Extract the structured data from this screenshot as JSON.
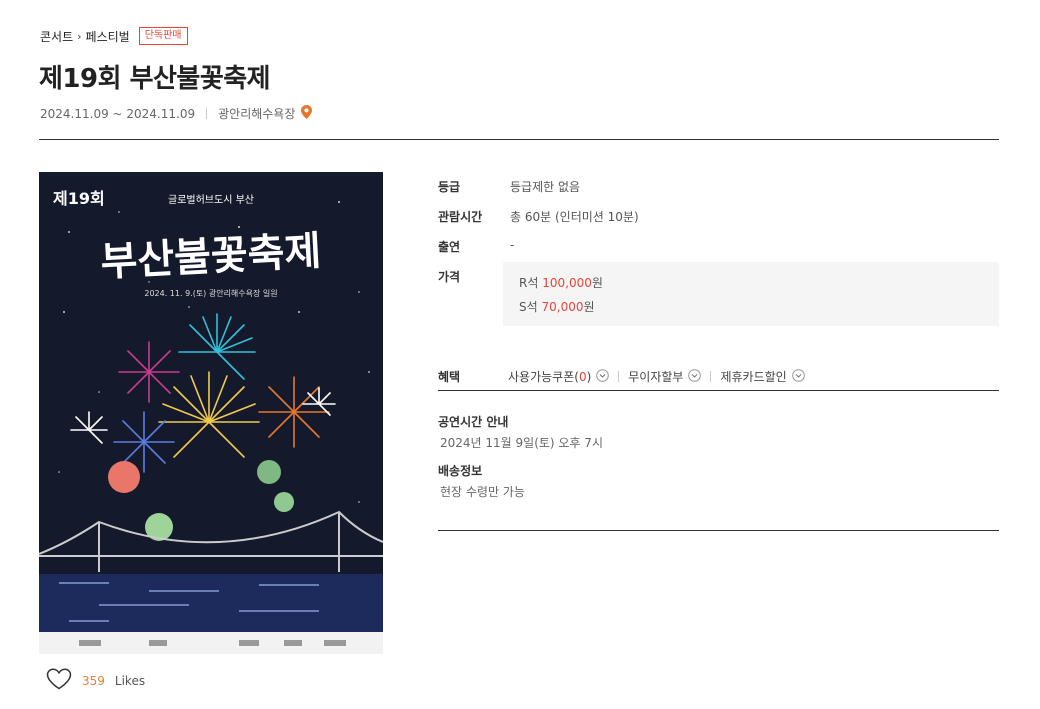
{
  "breadcrumb": {
    "category": "콘서트",
    "separator": "›",
    "subcategory": "페스티벌",
    "badge": "단독판매"
  },
  "title": "제19회 부산불꽃축제",
  "meta": {
    "date_range": "2024.11.09 ~ 2024.11.09",
    "venue": "광안리해수욕장",
    "pin_icon": "location-pin-icon"
  },
  "poster": {
    "round_badge": "제19회",
    "organizer_line": "글로벌허브도시 부산",
    "calligraphy_title": "부산불꽃축제",
    "date_line": "2024. 11. 9.(토)  광안리해수욕장 일원",
    "colors": {
      "background": "#141a2b",
      "sea": "#1d2a5c",
      "footer": "#f2f2f2"
    }
  },
  "likes": {
    "count": "359",
    "label": "Likes"
  },
  "info": {
    "grade": {
      "label": "등급",
      "value": "등급제한 없음"
    },
    "runtime": {
      "label": "관람시간",
      "value": "총 60분 (인터미션 10분)"
    },
    "cast": {
      "label": "출연",
      "value": "-"
    },
    "price": {
      "label": "가격",
      "items": [
        {
          "seat": "R석",
          "amount": "100,000",
          "unit": "원"
        },
        {
          "seat": "S석",
          "amount": "70,000",
          "unit": "원"
        }
      ]
    },
    "benefits": {
      "label": "혜택",
      "coupon": {
        "label": "사용가능쿠폰",
        "open": "(",
        "count": "0",
        "close": ")"
      },
      "installment": "무이자할부",
      "card": "제휴카드할인"
    }
  },
  "schedule": {
    "title": "공연시간 안내",
    "text": "2024년 11월 9일(토) 오후 7시"
  },
  "delivery": {
    "title": "배송정보",
    "text": "현장 수령만 가능"
  },
  "colors": {
    "accent_red": "#e3453b",
    "likes_orange": "#e87d3e",
    "pin_orange": "#e8762d"
  }
}
